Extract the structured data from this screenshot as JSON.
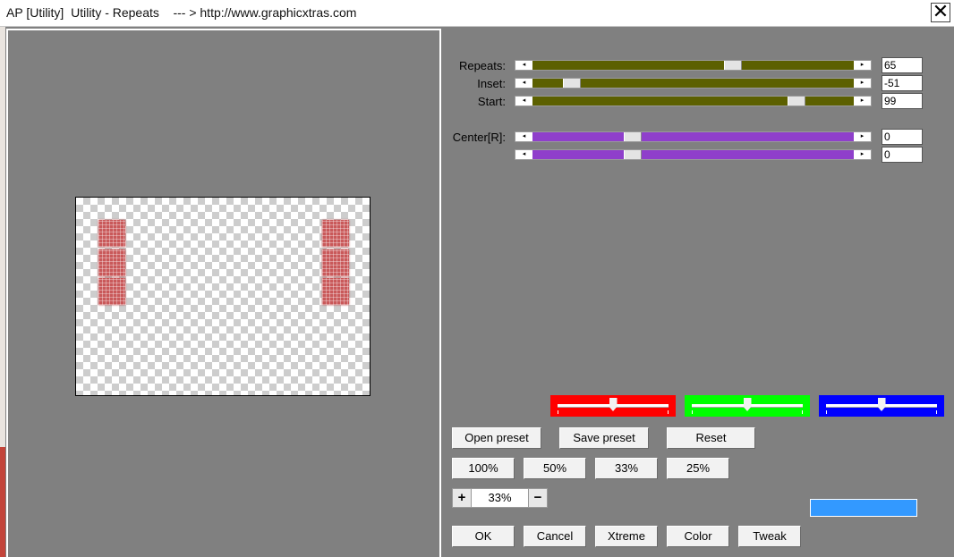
{
  "window": {
    "title": "AP [Utility]  Utility - Repeats    --- > http://www.graphicxtras.com",
    "close_glyph": "✕"
  },
  "params": {
    "repeats": {
      "label": "Repeats:",
      "value": "65",
      "level": 0.63
    },
    "inset": {
      "label": "Inset:",
      "value": "-51",
      "level": 0.1
    },
    "start": {
      "label": "Start:",
      "value": "99",
      "level": 0.84
    },
    "center_x": {
      "label": "Center[R]:",
      "value": "0",
      "level": 0.3
    },
    "center_y": {
      "label": "",
      "value": "0",
      "level": 0.3
    },
    "arrow_left": "◂",
    "arrow_right": "▸"
  },
  "color_sliders": [
    {
      "name": "red",
      "color": "#ff0000",
      "level": 0.5
    },
    {
      "name": "green",
      "color": "#00ff00",
      "level": 0.5
    },
    {
      "name": "blue",
      "color": "#0000ff",
      "level": 0.5
    }
  ],
  "buttons": {
    "open_preset": "Open preset",
    "save_preset": "Save preset",
    "reset": "Reset",
    "zoom_100": "100%",
    "zoom_50": "50%",
    "zoom_33": "33%",
    "zoom_25": "25%",
    "ok": "OK",
    "cancel": "Cancel",
    "xtreme": "Xtreme",
    "color": "Color",
    "tweak": "Tweak"
  },
  "zoom": {
    "plus": "+",
    "value": "33%",
    "minus": "−"
  },
  "colors": {
    "swatch": "#3399ff",
    "slider_olive": "#5c6000",
    "slider_purple": "#8f3fcb"
  }
}
